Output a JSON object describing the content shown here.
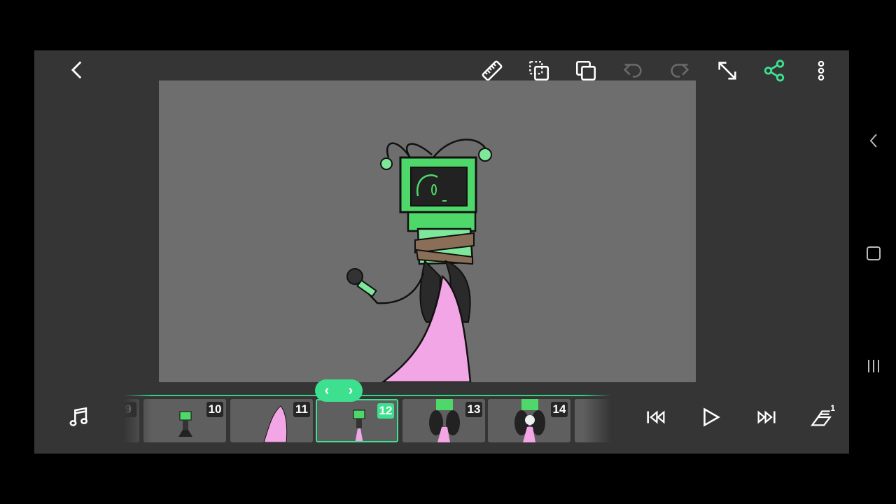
{
  "toolbar": {
    "icons": [
      "back-arrow-icon",
      "ruler-icon",
      "copy-frame-icon",
      "duplicate-icon",
      "undo-icon",
      "redo-icon",
      "fullscreen-icon",
      "share-icon",
      "more-vert-icon"
    ]
  },
  "colors": {
    "accent": "#3ce08f",
    "background": "#353535",
    "canvas": "#6e6e6e",
    "pink": "#f3a6e6"
  },
  "timeline": {
    "frames": [
      {
        "number": "9",
        "selected": false
      },
      {
        "number": "10",
        "selected": false
      },
      {
        "number": "11",
        "selected": false
      },
      {
        "number": "12",
        "selected": true
      },
      {
        "number": "13",
        "selected": false
      },
      {
        "number": "14",
        "selected": false
      }
    ],
    "layers_badge": "1"
  }
}
